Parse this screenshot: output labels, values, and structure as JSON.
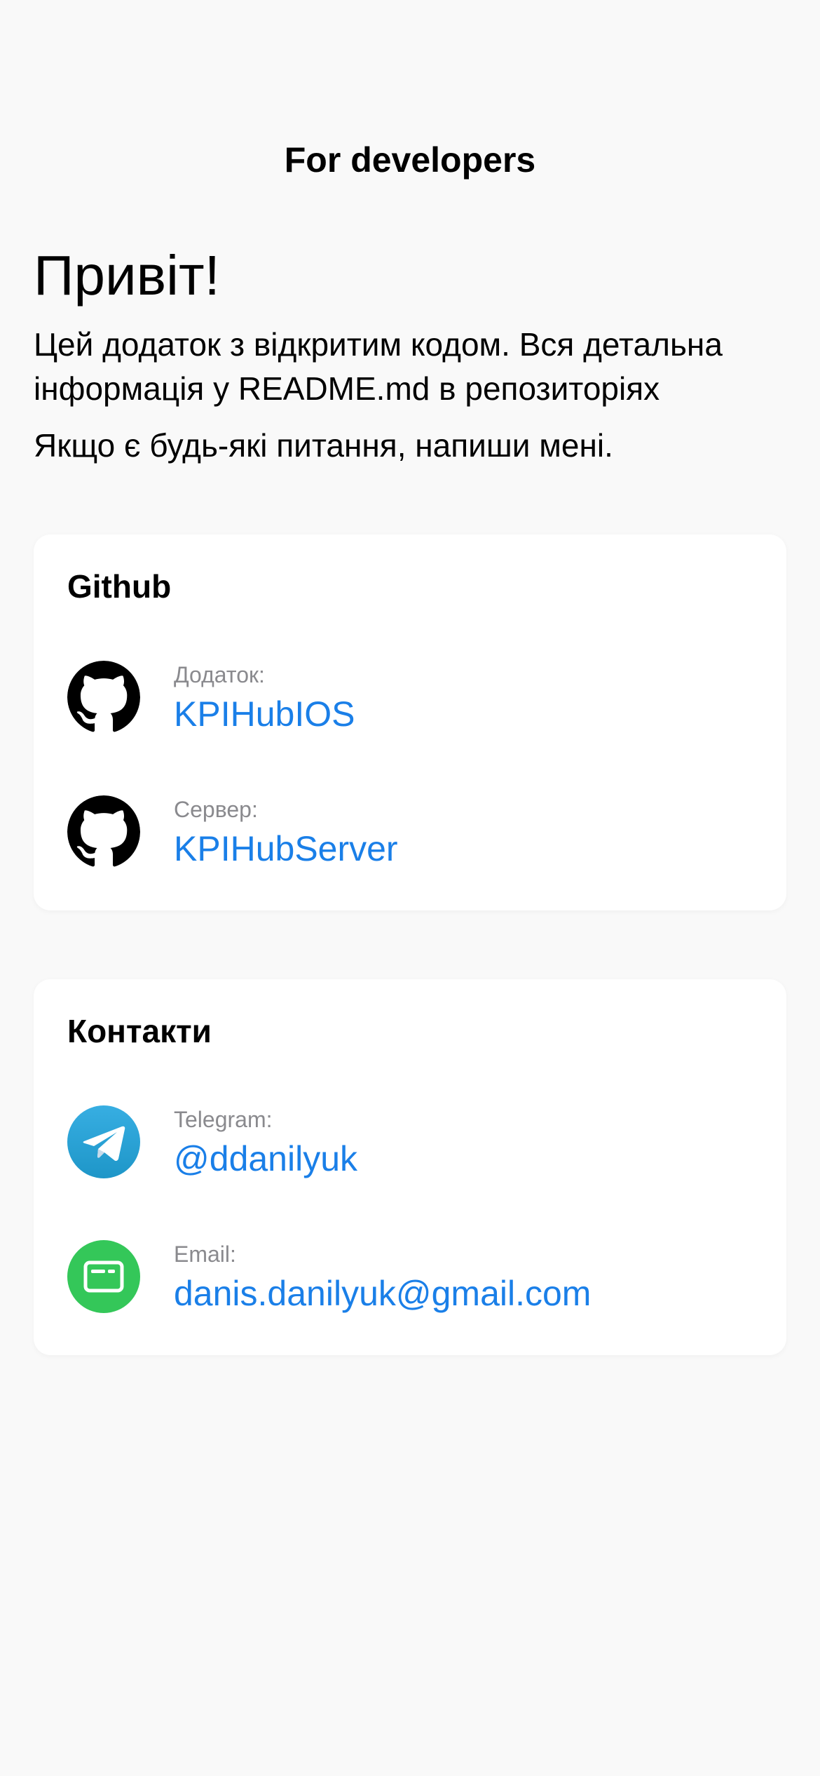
{
  "header": {
    "title": "For developers"
  },
  "intro": {
    "greeting": "Привіт!",
    "description": "Цей додаток з відкритим кодом. Вся детальна інформація у README.md в репозиторіях",
    "contact_note": "Якщо є будь-які питання, напиши мені."
  },
  "github": {
    "title": "Github",
    "items": [
      {
        "label": "Додаток:",
        "link": "KPIHubIOS",
        "icon": "github-icon"
      },
      {
        "label": "Сервер:",
        "link": "KPIHubServer",
        "icon": "github-icon"
      }
    ]
  },
  "contacts": {
    "title": "Контакти",
    "items": [
      {
        "label": "Telegram:",
        "link": "@ddanilyuk",
        "icon": "telegram-icon"
      },
      {
        "label": "Email:",
        "link": "danis.danilyuk@gmail.com",
        "icon": "email-icon"
      }
    ]
  },
  "colors": {
    "background": "#F9F9F9",
    "card": "#FFFFFF",
    "link": "#1A7FE8",
    "secondary_text": "#8A8A8E",
    "telegram": "#2AA3DA",
    "email": "#34C759"
  }
}
